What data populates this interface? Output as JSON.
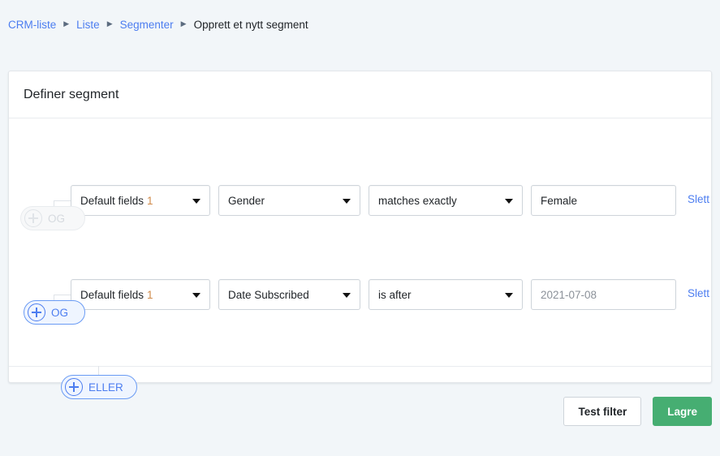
{
  "breadcrumb": {
    "separator": "▶",
    "items": [
      {
        "label": "CRM-liste",
        "current": false
      },
      {
        "label": "Liste",
        "current": false
      },
      {
        "label": "Segmenter",
        "current": false
      },
      {
        "label": "Opprett et nytt segment",
        "current": true
      }
    ]
  },
  "card": {
    "title": "Definer segment"
  },
  "conditions": [
    {
      "field_group": "Default fields",
      "field_group_count": "1",
      "property": "Gender",
      "operator": "matches exactly",
      "value": "Female",
      "value_placeholder": "",
      "delete_label": "Slett"
    },
    {
      "field_group": "Default fields",
      "field_group_count": "1",
      "property": "Date Subscribed",
      "operator": "is after",
      "value": "",
      "value_placeholder": "2021-07-08",
      "delete_label": "Slett"
    }
  ],
  "group_buttons": {
    "and_disabled_label": "OG",
    "and_active_label": "OG",
    "or_label": "ELLER"
  },
  "footer": {
    "test_filter_label": "Test filter",
    "save_label": "Lagre"
  },
  "colors": {
    "page_background": "#f2f6f9",
    "link": "#4c7df0",
    "primary_button": "#46ae72",
    "field_count_accent": "#d08a4a",
    "border": "#ced4da"
  }
}
